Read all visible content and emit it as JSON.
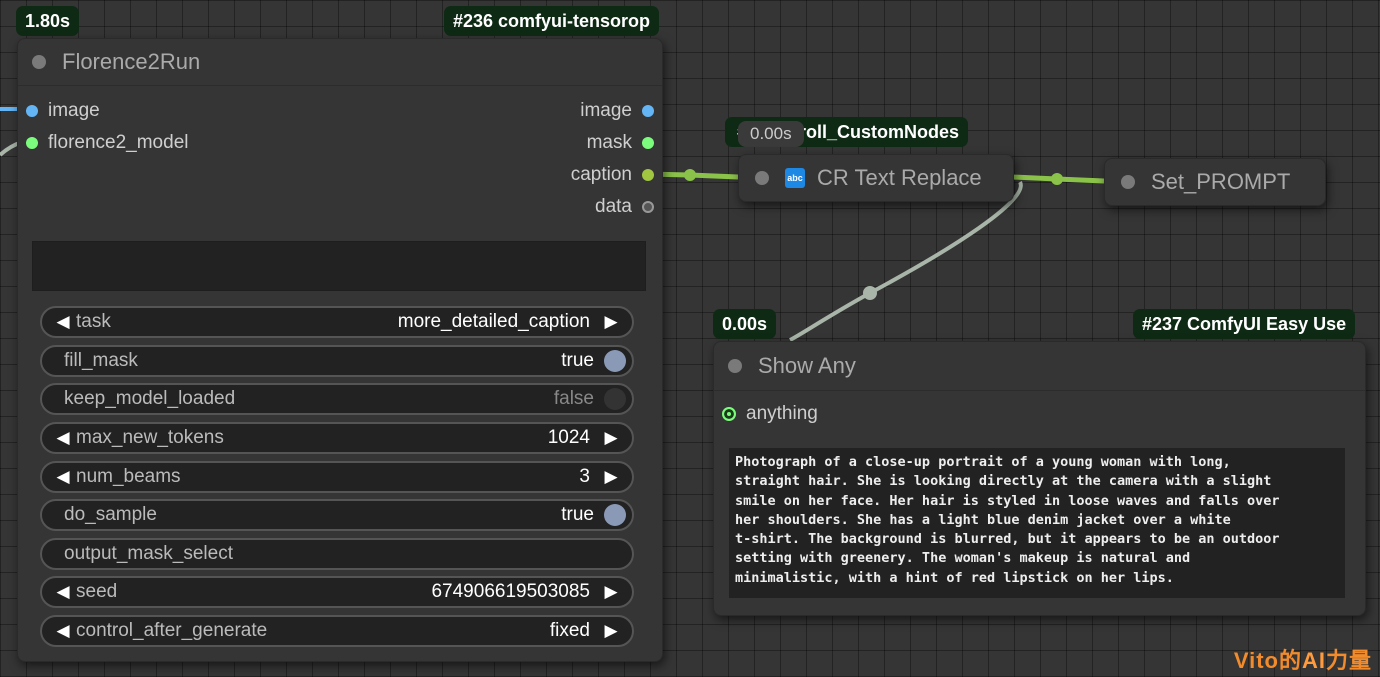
{
  "florence": {
    "time": "1.80s",
    "pack": "#236 comfyui-tensorop",
    "title": "Florence2Run",
    "inputs": [
      "image",
      "florence2_model"
    ],
    "outputs": [
      "image",
      "mask",
      "caption",
      "data"
    ],
    "widgets": {
      "task": {
        "label": "task",
        "value": "more_detailed_caption"
      },
      "fill_mask": {
        "label": "fill_mask",
        "value": "true"
      },
      "keep_model_loaded": {
        "label": "keep_model_loaded",
        "value": "false"
      },
      "max_new_tokens": {
        "label": "max_new_tokens",
        "value": "1024"
      },
      "num_beams": {
        "label": "num_beams",
        "value": "3"
      },
      "do_sample": {
        "label": "do_sample",
        "value": "true"
      },
      "output_mask_select": {
        "label": "output_mask_select",
        "value": ""
      },
      "seed": {
        "label": "seed",
        "value": "674906619503085"
      },
      "control_after_generate": {
        "label": "control_after_generate",
        "value": "fixed"
      }
    }
  },
  "replace": {
    "pack": "#... mfyroll_CustomNodes",
    "time": "0.00s",
    "title": "CR Text Replace",
    "icon_text": "abc"
  },
  "setprompt": {
    "title": "Set_PROMPT"
  },
  "showany": {
    "time": "0.00s",
    "pack": "#237 ComfyUI Easy Use",
    "title": "Show Any",
    "input": "anything",
    "text": "Photograph of a close-up portrait of a young woman with long,\nstraight hair. She is looking directly at the camera with a slight\nsmile on her face. Her hair is styled in loose waves and falls over\nher shoulders. She has a light blue denim jacket over a white\nt-shirt. The background is blurred, but it appears to be an outdoor\nsetting with greenery. The woman's makeup is natural and\nminimalistic, with a hint of red lipstick on her lips."
  },
  "watermark": {
    "pre": "Vito的",
    "ai": "AI",
    "post": "力量"
  },
  "colors": {
    "image_port": "#64b5f6",
    "model_port": "#7cfc7c",
    "string_port": "#a1c640",
    "data_port": "#a0a0a0",
    "link_string": "#8bc34a",
    "link_any": "#a8b5a8"
  }
}
